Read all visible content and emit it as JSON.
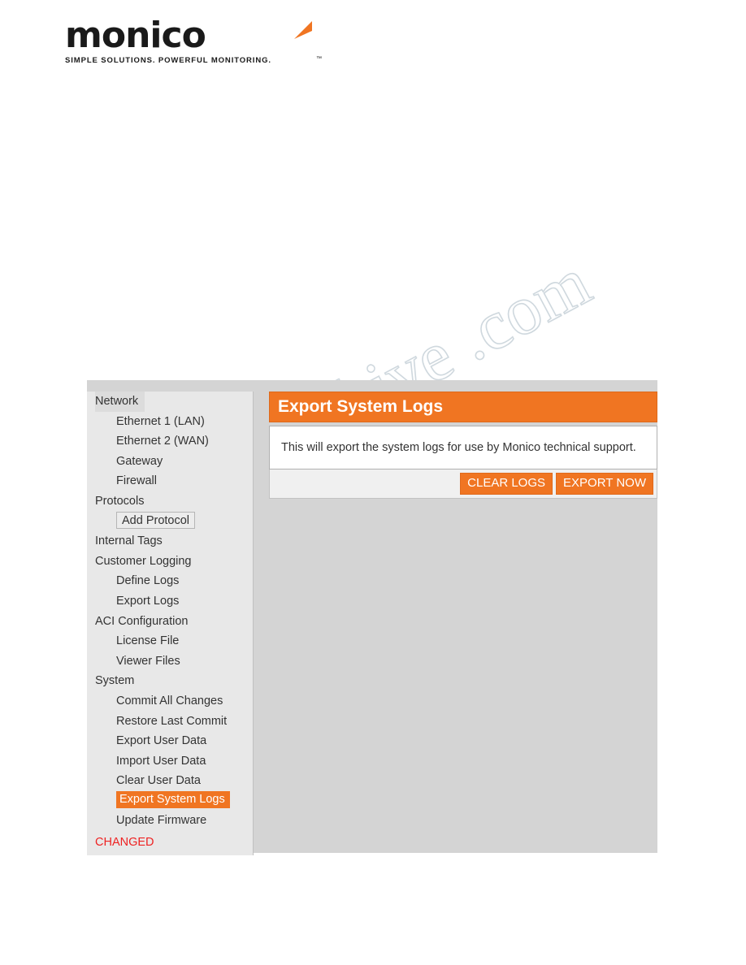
{
  "logo": {
    "wordmark": "monico",
    "tagline": "SIMPLE SOLUTIONS. POWERFUL MONITORING.",
    "trademark": "™"
  },
  "watermark": {
    "text": "manualshive .com"
  },
  "sidebar": {
    "items": [
      {
        "label": "Network",
        "level": 0,
        "style": "group-head"
      },
      {
        "label": "Ethernet 1 (LAN)",
        "level": 1,
        "style": "plain"
      },
      {
        "label": "Ethernet 2 (WAN)",
        "level": 1,
        "style": "plain"
      },
      {
        "label": "Gateway",
        "level": 1,
        "style": "plain"
      },
      {
        "label": "Firewall",
        "level": 1,
        "style": "plain"
      },
      {
        "label": "Protocols",
        "level": 0,
        "style": "plain"
      },
      {
        "label": "Add Protocol",
        "level": 1,
        "style": "boxed"
      },
      {
        "label": "Internal Tags",
        "level": 0,
        "style": "plain"
      },
      {
        "label": "Customer Logging",
        "level": 0,
        "style": "plain"
      },
      {
        "label": "Define Logs",
        "level": 1,
        "style": "plain"
      },
      {
        "label": "Export Logs",
        "level": 1,
        "style": "plain"
      },
      {
        "label": "ACI Configuration",
        "level": 0,
        "style": "plain"
      },
      {
        "label": "License File",
        "level": 1,
        "style": "plain"
      },
      {
        "label": "Viewer Files",
        "level": 1,
        "style": "plain"
      },
      {
        "label": "System",
        "level": 0,
        "style": "plain"
      },
      {
        "label": "Commit All Changes",
        "level": 1,
        "style": "plain"
      },
      {
        "label": "Restore Last Commit",
        "level": 1,
        "style": "plain"
      },
      {
        "label": "Export User Data",
        "level": 1,
        "style": "plain"
      },
      {
        "label": "Import User Data",
        "level": 1,
        "style": "plain"
      },
      {
        "label": "Clear User Data",
        "level": 1,
        "style": "plain"
      },
      {
        "label": "Export System Logs",
        "level": 1,
        "style": "selected"
      },
      {
        "label": "Update Firmware",
        "level": 1,
        "style": "plain"
      }
    ],
    "status": "CHANGED"
  },
  "panel": {
    "title": "Export System Logs",
    "description": "This will export the system logs for use by Monico technical support.",
    "buttons": [
      {
        "label": "CLEAR LOGS",
        "name": "clear-logs-button"
      },
      {
        "label": "EXPORT NOW",
        "name": "export-now-button"
      }
    ]
  },
  "colors": {
    "accent": "#f07522",
    "sidebar_bg": "#e8e8e8",
    "window_bg": "#d4d4d4",
    "status_red": "#ee2222"
  }
}
